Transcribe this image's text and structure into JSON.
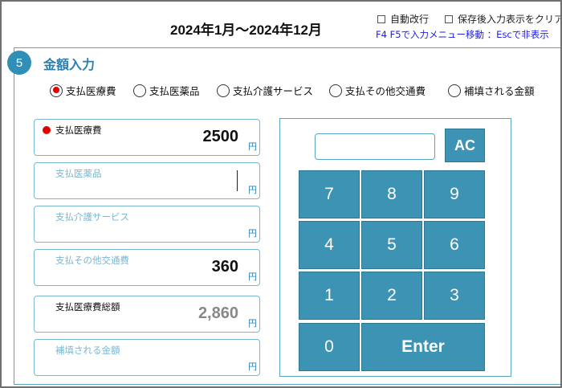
{
  "header": {
    "period": "2024年1月～2024年12月",
    "auto_newline_label": "自動改行",
    "save_clear_label": "保存後入力表示をクリア",
    "hint": "F4 F5で入力メニュー移動 ：Escで非表示"
  },
  "section": {
    "number": "5",
    "title": "金額入力"
  },
  "radios": [
    {
      "label": "支払医療費",
      "selected": true
    },
    {
      "label": "支払医薬品",
      "selected": false
    },
    {
      "label": "支払介護サービス",
      "selected": false
    },
    {
      "label": "支払その他交通費",
      "selected": false
    },
    {
      "label": "補填される金額",
      "selected": false
    }
  ],
  "fields": [
    {
      "label": "支払医療費",
      "value": "2500",
      "unit": "円"
    },
    {
      "label": "支払医薬品",
      "value": "",
      "unit": "円"
    },
    {
      "label": "支払介護サービス",
      "value": "",
      "unit": "円"
    },
    {
      "label": "支払その他交通費",
      "value": "360",
      "unit": "円"
    },
    {
      "label": "支払医療費総額",
      "value": "2,860",
      "unit": "円"
    },
    {
      "label": "補填される金額",
      "value": "",
      "unit": "円"
    }
  ],
  "keypad": {
    "display_value": "",
    "ac": "AC",
    "k7": "7",
    "k8": "8",
    "k9": "9",
    "k4": "4",
    "k5": "5",
    "k6": "6",
    "k1": "1",
    "k2": "2",
    "k3": "3",
    "k0": "0",
    "enter": "Enter"
  },
  "colors": {
    "accent": "#3d93b4",
    "border": "#5aa3c2",
    "selected": "#e00000",
    "hint": "#1e1ee6"
  }
}
